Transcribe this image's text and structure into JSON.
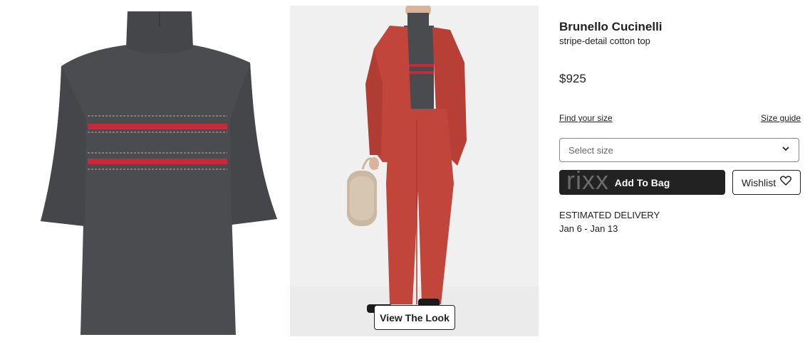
{
  "product": {
    "brand": "Brunello Cucinelli",
    "description": "stripe-detail cotton top",
    "price": "$925"
  },
  "sizing": {
    "find_size_label": "Find your size",
    "size_guide_label": "Size guide",
    "select_placeholder": "Select size"
  },
  "actions": {
    "add_to_bag_label": "Add To Bag",
    "add_to_bag_watermark": "rixx",
    "wishlist_label": "Wishlist"
  },
  "delivery": {
    "heading": "ESTIMATED DELIVERY",
    "dates": "Jan 6 - Jan 13"
  },
  "gallery": {
    "view_look_label": "View The Look"
  },
  "icons": {
    "select_chevron": "chevron-down-icon",
    "wishlist": "heart-icon"
  },
  "colors": {
    "garment_gray": "#4b4c50",
    "stripe_red": "#c8283a",
    "suit_red": "#c2453b",
    "button_dark": "#222222"
  }
}
